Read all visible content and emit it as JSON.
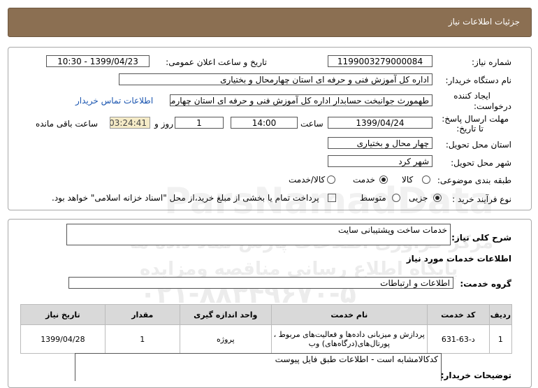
{
  "header": {
    "title": "جزئیات اطلاعات نیاز"
  },
  "form": {
    "need_number_label": "شماره نیاز:",
    "need_number": "1199003279000084",
    "announce_label": "تاریخ و ساعت اعلان عمومی:",
    "announce_value": "1399/04/23 - 10:30",
    "buyer_label": "نام دستگاه خریدار:",
    "buyer_value": "اداره کل آموزش فنی و حرفه ای استان چهارمحال و بختیاری",
    "creator_label_1": "ایجاد کننده",
    "creator_label_2": "درخواست:",
    "creator_value": "طهمورث جوانبخت حسابدار اداره کل آموزش فنی و حرفه ای استان چهارمحال و بختیاری",
    "contact_link": "اطلاعات تماس خریدار",
    "deadline_label_1": "مهلت ارسال پاسخ:",
    "deadline_label_2": "تا تاریخ:",
    "deadline_date": "1399/04/24",
    "time_label": "ساعت",
    "deadline_time": "14:00",
    "days_value": "1",
    "days_label": "روز و",
    "remaining_time": "03:24:41",
    "remaining_label": "ساعت باقی مانده",
    "province_label": "استان محل تحویل:",
    "province_value": "چهار محال و بختیاری",
    "city_label": "شهر محل تحویل:",
    "city_value": "شهر کرد",
    "category_label": "طبقه بندی موضوعی:",
    "category_options": [
      "کالا",
      "خدمت",
      "کالا/خدمت"
    ],
    "category_selected": "خدمت",
    "process_label": "نوع فرآیند خرید :",
    "process_options": [
      "جزیی",
      "متوسط"
    ],
    "process_selected": "جزیی",
    "payment_note": "پرداخت تمام یا بخشی از مبلغ خرید،از محل \"اسناد خزانه اسلامی\" خواهد بود."
  },
  "summary": {
    "label": "شرح کلی نیاز:",
    "value": "خدمات ساخت وپشتیبانی سایت"
  },
  "services": {
    "section_title": "اطلاعات خدمات مورد نیاز",
    "group_label": "گروه خدمت:",
    "group_value": "اطلاعات و ارتباطات",
    "columns": [
      "ردیف",
      "کد خدمت",
      "نام خدمت",
      "واحد اندازه گیری",
      "مقدار",
      "تاریخ نیاز"
    ],
    "rows": [
      {
        "idx": "1",
        "code": "د-63-631",
        "name_1": "پردازش و میزبانی داده‌ها و فعالیت‌های مربوط ،",
        "name_2": "پورتال‌های(درگاه‌های) وب",
        "unit": "پروژه",
        "qty": "1",
        "date": "1399/04/28"
      }
    ]
  },
  "buyer_notes": {
    "label": "توضیحات خریدار:",
    "value": "کدکالامشابه است - اطلاعات طبق فایل پیوست"
  },
  "watermark": {
    "line1": "ParsNamadData",
    "line2": "مرکز فراوری اطلاعات پارس نماد داده ها",
    "line3": "پایگاه اطلاع رسانی مناقصه ومزایده",
    "line4": "۰۲۱-۸۸۳۴۹۶۷۰-۵"
  }
}
